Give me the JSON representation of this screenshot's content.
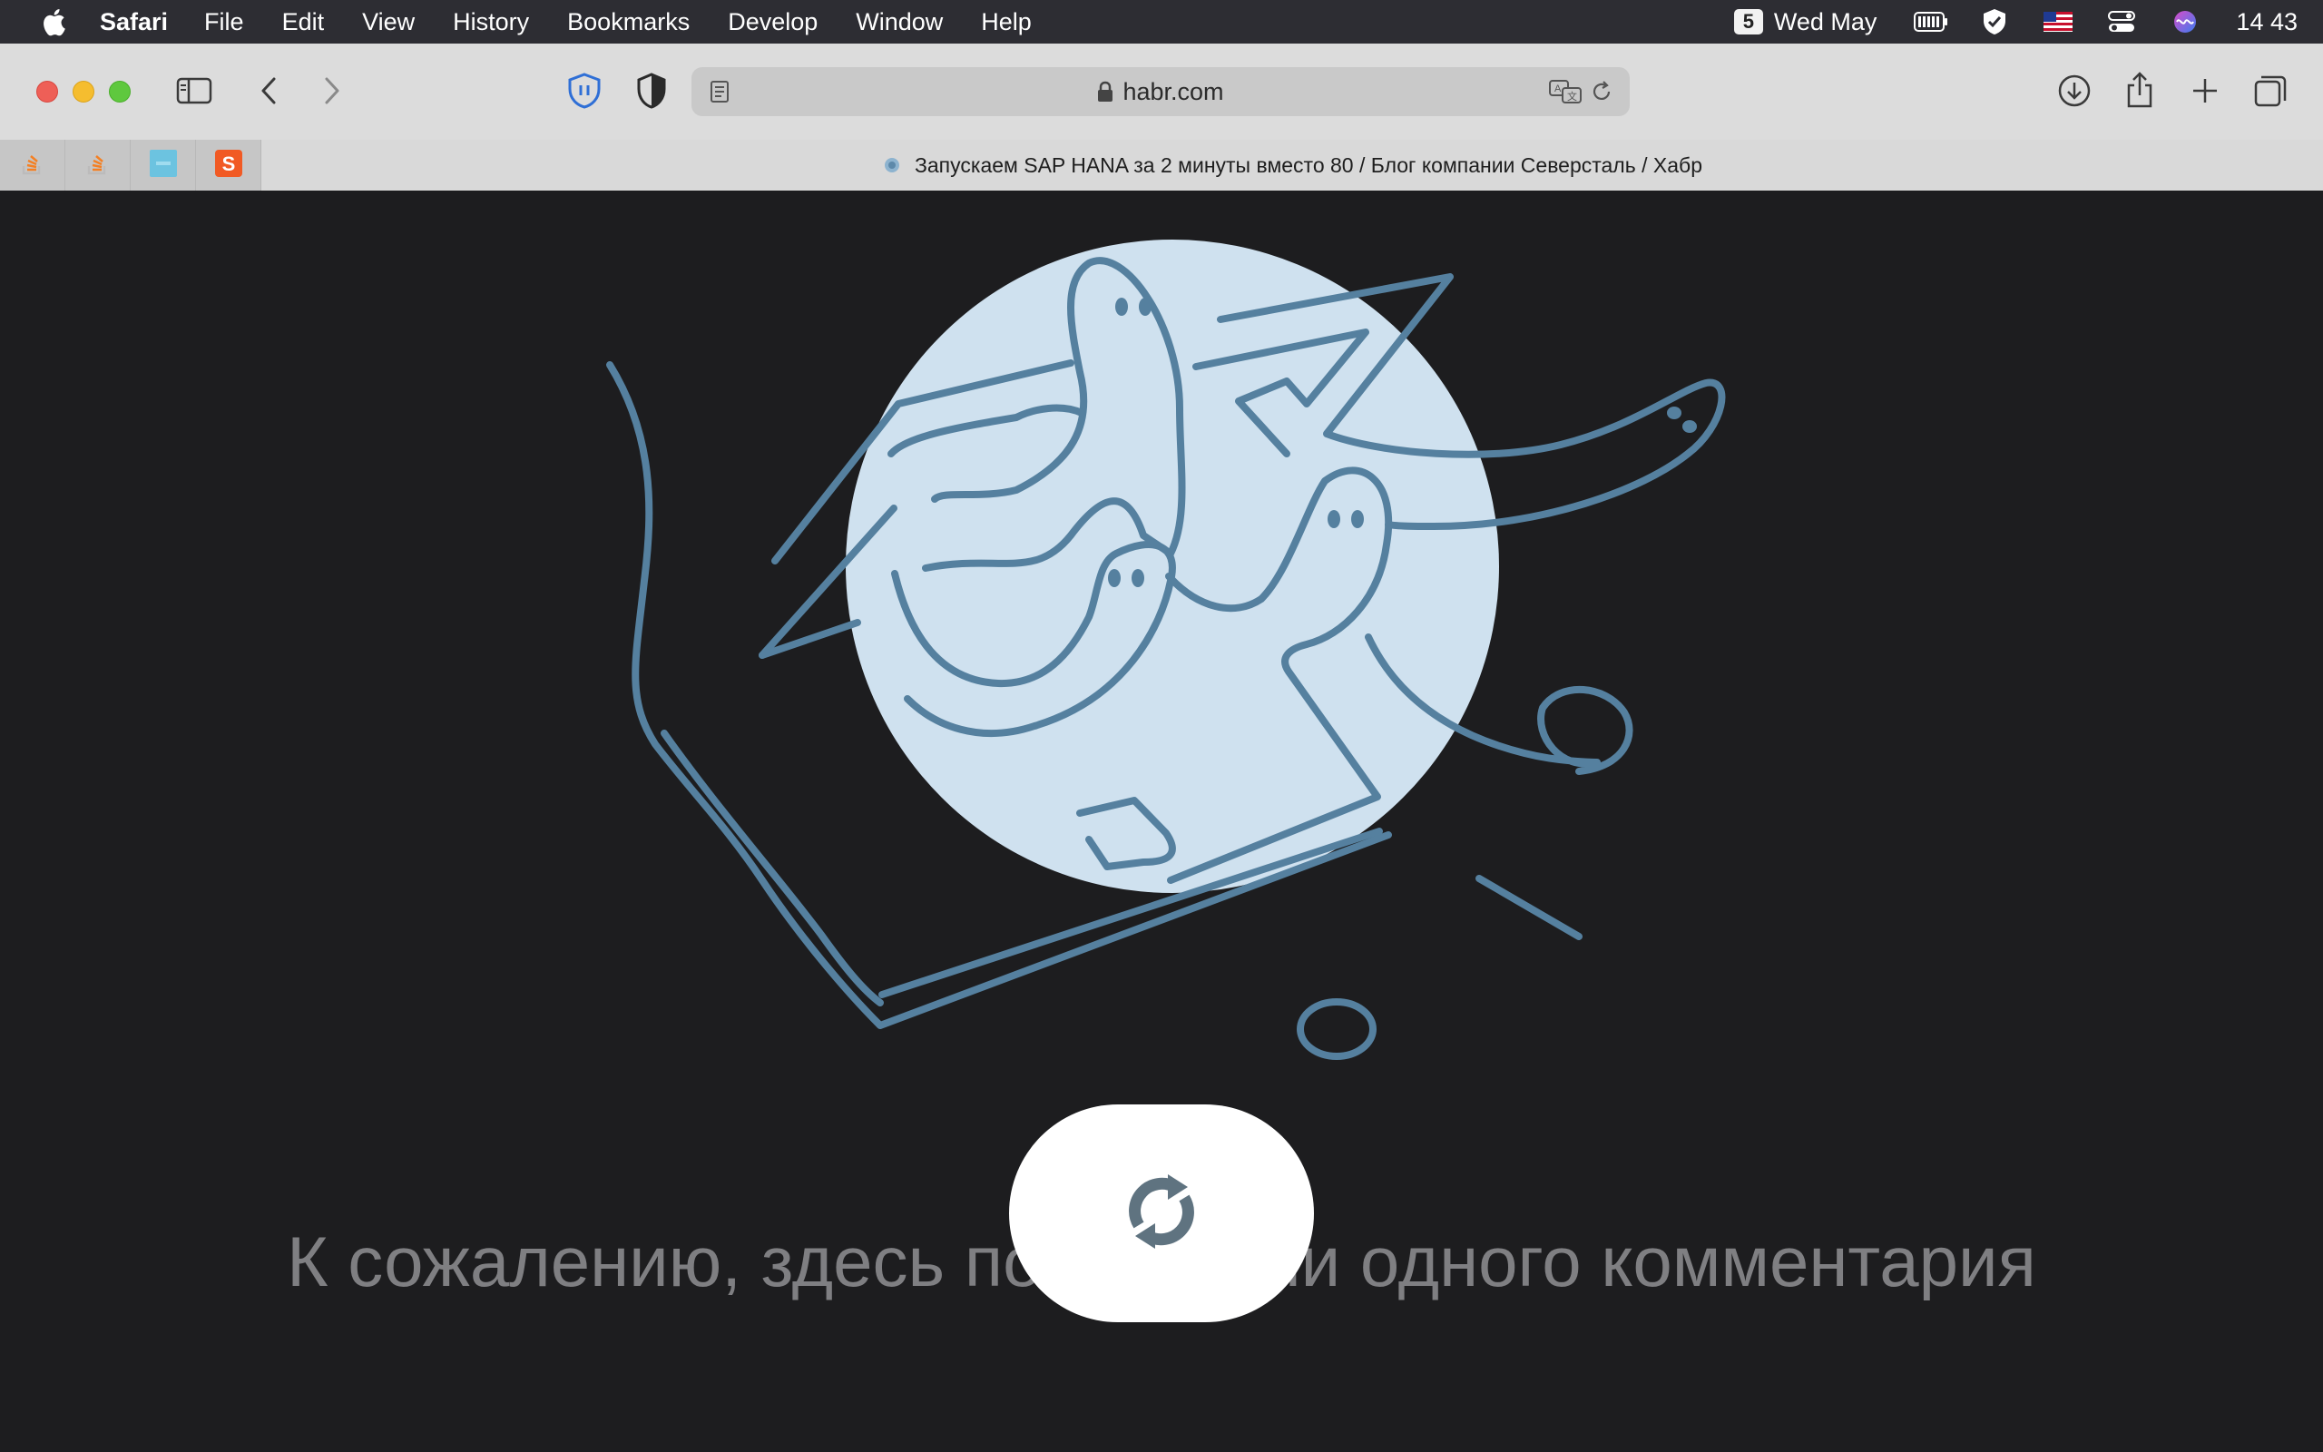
{
  "menubar": {
    "app_name": "Safari",
    "items": [
      "File",
      "Edit",
      "View",
      "History",
      "Bookmarks",
      "Develop",
      "Window",
      "Help"
    ],
    "date_badge": "5",
    "date_text": "Wed May",
    "clock": "14 43",
    "status_icons": [
      "battery-icon",
      "checkmark-shield-icon",
      "us-flag-icon",
      "control-center-icon",
      "siri-icon"
    ]
  },
  "toolbar": {
    "url": "habr.com",
    "icons": [
      "sidebar-icon",
      "back-icon",
      "forward-icon",
      "privacy-shield-icon",
      "half-shield-icon",
      "reader-icon",
      "translate-icon",
      "reload-icon",
      "download-icon",
      "share-icon",
      "new-tab-icon",
      "tab-overview-icon"
    ]
  },
  "tabs": {
    "pinned": [
      "stackoverflow-icon",
      "stackoverflow-icon",
      "blue-tile-icon",
      "orange-s-icon"
    ],
    "active_title": "Запускаем SAP HANA за 2 минуты вместо 80 / Блог компании Северсталь / Хабр"
  },
  "page": {
    "message": "К сожалению, здесь пока нет ни одного комментария",
    "colors": {
      "background": "#1d1d1f",
      "illustration_stroke": "#55809f",
      "illustration_fill": "#cfe1ef",
      "message": "#7f7f82",
      "reload_icon": "#5f7380"
    }
  }
}
